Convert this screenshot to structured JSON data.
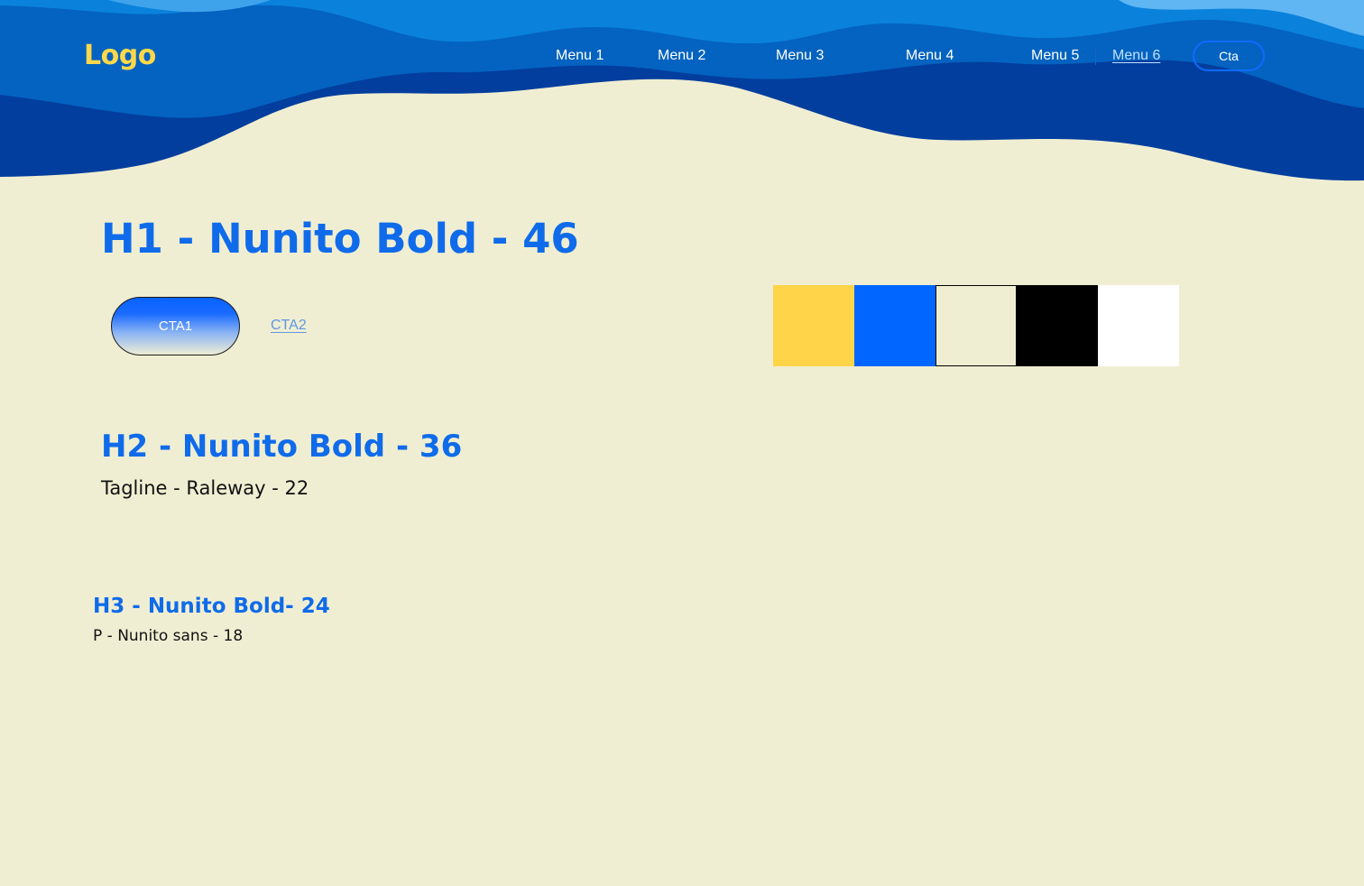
{
  "header": {
    "logo": "Logo",
    "menu": [
      {
        "label": "Menu 1"
      },
      {
        "label": "Menu 2"
      },
      {
        "label": "Menu 3"
      },
      {
        "label": "Menu 4"
      },
      {
        "label": "Menu 5"
      },
      {
        "label": "Menu 6",
        "active": true
      }
    ],
    "cta_label": "Cta"
  },
  "hero": {
    "h1": "H1 - Nunito Bold - 46",
    "cta1_label": "CTA1",
    "cta2_label": "CTA2"
  },
  "palette": {
    "swatches": [
      {
        "color": "#FFD449"
      },
      {
        "color": "#0066FF"
      },
      {
        "color": "#F0EED2",
        "bordered": true
      },
      {
        "color": "#000000"
      },
      {
        "color": "#FFFFFF"
      }
    ]
  },
  "typography": {
    "h2": "H2 - Nunito Bold - 36",
    "tagline": "Tagline - Raleway - 22",
    "h3": "H3 - Nunito Bold- 24",
    "paragraph": "P - Nunito sans - 18"
  },
  "colors": {
    "background": "#F0EED2",
    "wave_light": "#5FB6F2",
    "wave_mid": "#0A82DC",
    "wave_dark": "#0463C0",
    "wave_deep": "#023E9E",
    "logo": "#FFD84A",
    "heading": "#0F6BEA"
  }
}
